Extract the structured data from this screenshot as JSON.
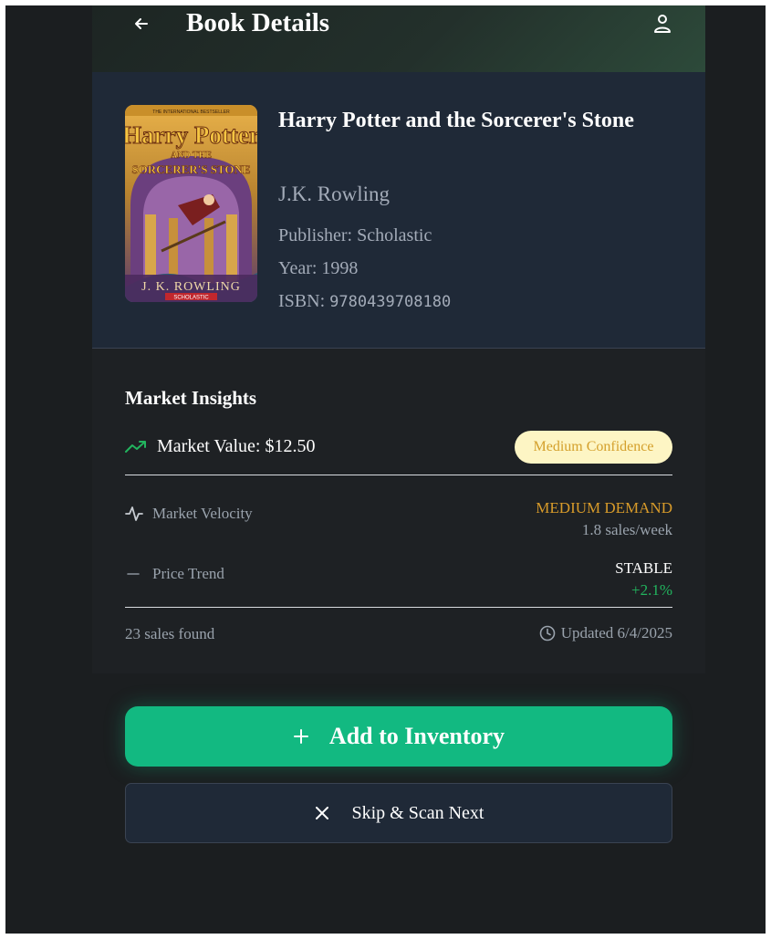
{
  "header": {
    "title": "Book Details",
    "back_icon": "arrow-left-icon",
    "profile_icon": "user-icon"
  },
  "book": {
    "title": "Harry Potter and the Sorcerer's Stone",
    "author": "J.K. Rowling",
    "publisher_label": "Publisher: ",
    "publisher": "Scholastic",
    "year_label": "Year: ",
    "year": "1998",
    "isbn_label": "ISBN: ",
    "isbn": "9780439708180",
    "cover": {
      "top_text": "THE INTERNATIONAL BESTSELLER",
      "title_line1": "Harry Potter",
      "title_line2": "AND THE",
      "title_line3": "SORCERER'S STONE",
      "author_text": "J. K. ROWLING",
      "publisher_text": "SCHOLASTIC"
    }
  },
  "market": {
    "heading": "Market Insights",
    "value_text": "Market Value: $12.50",
    "confidence_badge": "Medium Confidence",
    "velocity_label": "Market Velocity",
    "velocity_value": "MEDIUM DEMAND",
    "velocity_sub": "1.8 sales/week",
    "trend_label": "Price Trend",
    "trend_value": "STABLE",
    "trend_change": "+2.1%",
    "sales_found": "23 sales found",
    "updated": "Updated 6/4/2025"
  },
  "actions": {
    "add_label": "Add to Inventory",
    "skip_label": "Skip & Scan Next"
  },
  "colors": {
    "accent_green": "#12b981",
    "demand_orange": "#d89b2a",
    "badge_bg": "#fdf5c4",
    "positive": "#22b45e"
  }
}
